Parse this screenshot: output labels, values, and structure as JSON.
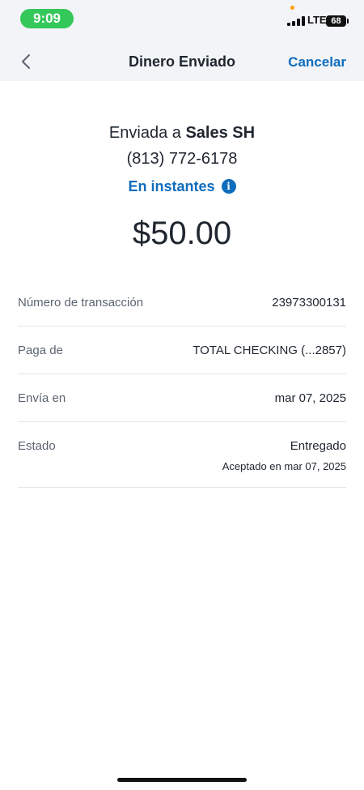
{
  "status_bar": {
    "time": "9:09",
    "network": "LTE",
    "battery": "68"
  },
  "nav": {
    "title": "Dinero Enviado",
    "cancel_label": "Cancelar",
    "back_icon": "chevron-left-icon"
  },
  "summary": {
    "sent_prefix": "Enviada a",
    "recipient_name": "Sales SH",
    "phone": "(813) 772-6178",
    "speed": "En instantes",
    "info_icon": "info-icon",
    "amount": "$50.00"
  },
  "details": [
    {
      "label": "Número de transacción",
      "value": "23973300131"
    },
    {
      "label": "Paga de",
      "value": "TOTAL CHECKING (...2857)"
    },
    {
      "label": "Envía en",
      "value": "mar 07, 2025"
    },
    {
      "label": "Estado",
      "value": "Entregado",
      "sub": "Aceptado en mar 07, 2025"
    }
  ],
  "colors": {
    "accent": "#0f6cbd",
    "header_bg": "#f2f4f8",
    "time_pill": "#34c759"
  }
}
